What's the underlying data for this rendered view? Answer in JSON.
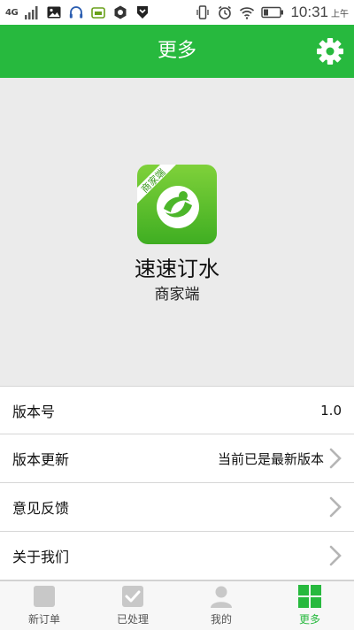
{
  "status_bar": {
    "network": "4G",
    "time": "10:31",
    "ampm": "上午"
  },
  "header": {
    "title": "更多",
    "settings_icon": "gear-icon"
  },
  "app": {
    "logo_badge": "商家端",
    "name": "速速订水",
    "subtitle": "商家端"
  },
  "list": {
    "rows": [
      {
        "label": "版本号",
        "value": "1.0"
      },
      {
        "label": "版本更新",
        "value": "当前已是最新版本"
      },
      {
        "label": "意见反馈",
        "value": ""
      },
      {
        "label": "关于我们",
        "value": ""
      }
    ]
  },
  "tabs": [
    {
      "label": "新订单",
      "icon": "new-order-icon",
      "active": false
    },
    {
      "label": "已处理",
      "icon": "checked-icon",
      "active": false
    },
    {
      "label": "我的",
      "icon": "user-icon",
      "active": false
    },
    {
      "label": "更多",
      "icon": "grid-icon",
      "active": true
    }
  ],
  "colors": {
    "brand_green": "#27b93e",
    "background": "#ebebeb",
    "tab_inactive": "#c8c8c8"
  }
}
